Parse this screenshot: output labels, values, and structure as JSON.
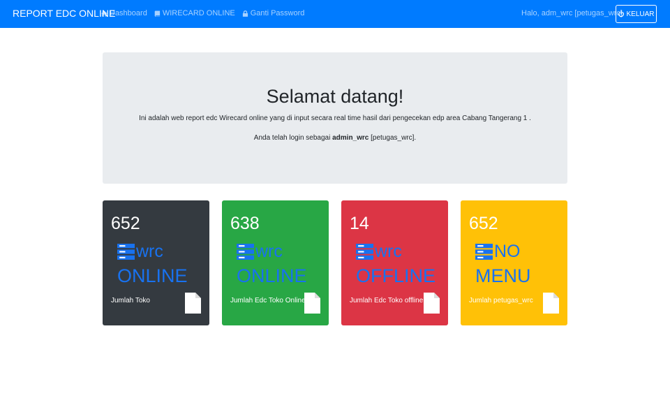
{
  "navbar": {
    "brand": "REPORT EDC ONLINE",
    "links": [
      {
        "label": "Dashboard",
        "icon": "home-icon"
      },
      {
        "label": "WIRECARD ONLINE",
        "icon": "book-icon"
      },
      {
        "label": "Ganti Password",
        "icon": "lock-icon"
      }
    ],
    "greeting": "Halo, adm_wrc [petugas_wrc]",
    "logout_label": "KELUAR",
    "logout_icon": "power-icon",
    "bg_color": "#007bff"
  },
  "jumbotron": {
    "title": "Selamat datang!",
    "lead": "Ini adalah web report edc Wirecard online yang di input secara real time hasil dari pengecekan edp area Cabang Tangerang 1 .",
    "login_prefix": "Anda telah login sebagai",
    "login_user": "admin_wrc",
    "login_suffix": "[petugas_wrc]."
  },
  "cards": [
    {
      "count": "652",
      "icon": "server-icon",
      "line1": "wrc",
      "line2": "ONLINE",
      "label": "Jumlah Toko",
      "color": "#343a40"
    },
    {
      "count": "638",
      "icon": "server-icon",
      "line1": "wrc",
      "line2": "ONLINE",
      "label": "Jumlah Edc Toko Online",
      "color": "#28a745"
    },
    {
      "count": "14",
      "icon": "server-icon",
      "line1": "wrc",
      "line2": "OFFLINE",
      "label": "Jumlah Edc Toko offline",
      "color": "#dc3545"
    },
    {
      "count": "652",
      "icon": "server-icon",
      "line1": "NO",
      "line2": "MENU",
      "label": "Jumlah petugas_wrc",
      "color": "#ffc107"
    }
  ],
  "accent_text_color": "#1872f0"
}
